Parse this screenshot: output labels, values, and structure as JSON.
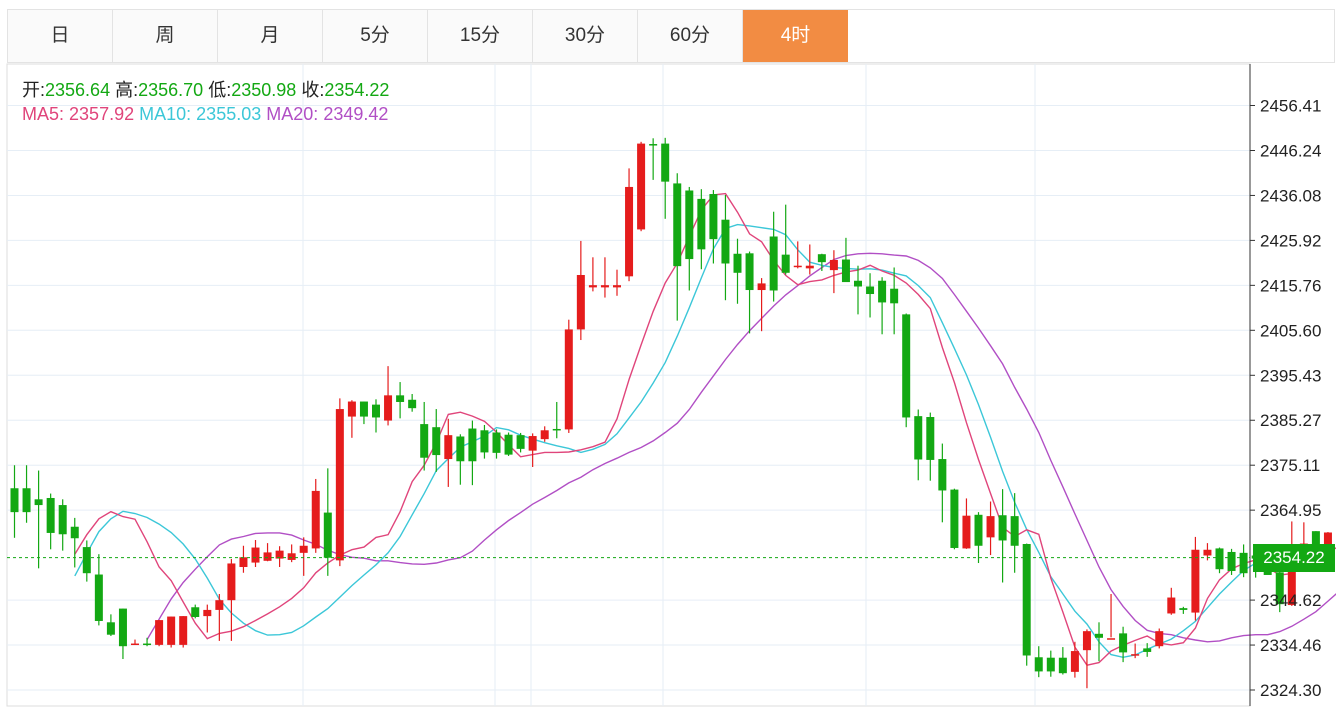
{
  "tabs": [
    {
      "label": "日",
      "active": false
    },
    {
      "label": "周",
      "active": false
    },
    {
      "label": "月",
      "active": false
    },
    {
      "label": "5分",
      "active": false
    },
    {
      "label": "15分",
      "active": false
    },
    {
      "label": "30分",
      "active": false
    },
    {
      "label": "60分",
      "active": false
    },
    {
      "label": "4时",
      "active": true
    }
  ],
  "colors": {
    "accent": "#f28c43",
    "up": "#e51c1c",
    "down": "#13a813",
    "ma5": "#e0457b",
    "ma10": "#3cc7d8",
    "ma20": "#b14fc5",
    "grid": "#e6eef6",
    "last_price": "#13a813"
  },
  "legend": {
    "open_label": "开:",
    "open_value": "2356.64",
    "high_label": "高:",
    "high_value": "2356.70",
    "low_label": "低:",
    "low_value": "2350.98",
    "close_label": "收:",
    "close_value": "2354.22",
    "ma5_label": "MA5:",
    "ma5_value": "2357.92",
    "ma10_label": "MA10:",
    "ma10_value": "2355.03",
    "ma20_label": "MA20:",
    "ma20_value": "2349.42"
  },
  "chart_data": {
    "type": "candlestick",
    "y_ticks": [
      "2456.41",
      "2446.24",
      "2436.08",
      "2425.92",
      "2415.76",
      "2405.60",
      "2395.43",
      "2385.27",
      "2375.11",
      "2364.95",
      "2344.62",
      "2334.46",
      "2324.30"
    ],
    "ylim": [
      2321.2,
      2466.0
    ],
    "last_price": "2354.22",
    "candles": [
      [
        2369.9,
        2364.5,
        2375.1,
        2358.7
      ],
      [
        2369.9,
        2364.5,
        2375.1,
        2362.1
      ],
      [
        2367.4,
        2366.1,
        2373.9,
        2351.8
      ],
      [
        2367.7,
        2359.8,
        2368.7,
        2356.1
      ],
      [
        2366.1,
        2359.5,
        2367.4,
        2355.8
      ],
      [
        2361.2,
        2358.6,
        2363.2,
        2352.0
      ],
      [
        2356.6,
        2350.7,
        2358.1,
        2348.8
      ],
      [
        2350.4,
        2339.9,
        2355.0,
        2338.9
      ],
      [
        2339.6,
        2336.8,
        2341.4,
        2336.5
      ],
      [
        2342.7,
        2334.2,
        2342.7,
        2331.3
      ],
      [
        2334.8,
        2334.8,
        2335.7,
        2334.5
      ],
      [
        2334.8,
        2334.5,
        2336.1,
        2334.2
      ],
      [
        2334.5,
        2340.1,
        2340.1,
        2334.2
      ],
      [
        2334.5,
        2340.9,
        2340.9,
        2333.9
      ],
      [
        2334.5,
        2341.0,
        2341.0,
        2333.9
      ],
      [
        2343.0,
        2340.8,
        2343.6,
        2340.5
      ],
      [
        2341.0,
        2342.4,
        2343.6,
        2337.3
      ],
      [
        2342.4,
        2344.6,
        2346.0,
        2335.4
      ],
      [
        2344.6,
        2352.9,
        2353.9,
        2335.4
      ],
      [
        2352.1,
        2354.3,
        2356.9,
        2350.8
      ],
      [
        2353.1,
        2356.5,
        2358.2,
        2352.1
      ],
      [
        2353.5,
        2355.4,
        2357.5,
        2353.4
      ],
      [
        2354.0,
        2355.8,
        2356.8,
        2352.1
      ],
      [
        2353.7,
        2355.2,
        2357.2,
        2353.2
      ],
      [
        2355.3,
        2356.9,
        2358.8,
        2350.1
      ],
      [
        2356.3,
        2369.3,
        2372.0,
        2355.3
      ],
      [
        2364.4,
        2354.2,
        2374.4,
        2350.1
      ],
      [
        2353.6,
        2387.8,
        2390.2,
        2352.3
      ],
      [
        2386.1,
        2389.5,
        2389.8,
        2381.3
      ],
      [
        2389.5,
        2386.1,
        2389.5,
        2384.4
      ],
      [
        2388.8,
        2385.9,
        2390.0,
        2382.5
      ],
      [
        2385.2,
        2390.9,
        2397.5,
        2384.1
      ],
      [
        2390.9,
        2389.4,
        2393.9,
        2385.7
      ],
      [
        2389.9,
        2388.0,
        2391.2,
        2387.2
      ],
      [
        2384.4,
        2376.8,
        2389.4,
        2373.9
      ],
      [
        2383.7,
        2377.4,
        2387.8,
        2373.6
      ],
      [
        2376.5,
        2381.9,
        2385.6,
        2370.2
      ],
      [
        2381.6,
        2376.0,
        2382.1,
        2370.7
      ],
      [
        2383.4,
        2376.0,
        2385.2,
        2370.6
      ],
      [
        2383.0,
        2378.0,
        2384.2,
        2376.6
      ],
      [
        2382.5,
        2377.9,
        2383.2,
        2376.6
      ],
      [
        2382.0,
        2377.5,
        2382.5,
        2377.2
      ],
      [
        2381.9,
        2378.8,
        2382.4,
        2378.0
      ],
      [
        2378.4,
        2381.7,
        2382.3,
        2374.7
      ],
      [
        2381.0,
        2383.0,
        2383.9,
        2380.4
      ],
      [
        2383.3,
        2383.2,
        2389.4,
        2381.2
      ],
      [
        2383.2,
        2405.8,
        2408.0,
        2382.4
      ],
      [
        2405.8,
        2418.1,
        2425.8,
        2403.4
      ],
      [
        2415.3,
        2415.8,
        2422.1,
        2414.4
      ],
      [
        2415.3,
        2415.8,
        2422.1,
        2413.0
      ],
      [
        2415.3,
        2415.8,
        2419.3,
        2413.4
      ],
      [
        2417.8,
        2438.0,
        2442.2,
        2416.7
      ],
      [
        2428.4,
        2447.8,
        2448.2,
        2428.0
      ],
      [
        2447.7,
        2447.5,
        2449.0,
        2439.6
      ],
      [
        2447.8,
        2439.2,
        2449.1,
        2430.8
      ],
      [
        2438.8,
        2420.1,
        2441.1,
        2407.8
      ],
      [
        2437.2,
        2421.7,
        2438.0,
        2414.6
      ],
      [
        2435.3,
        2423.9,
        2437.5,
        2419.4
      ],
      [
        2436.4,
        2426.2,
        2437.3,
        2420.7
      ],
      [
        2430.6,
        2420.7,
        2436.2,
        2412.4
      ],
      [
        2422.9,
        2418.6,
        2426.3,
        2411.6
      ],
      [
        2423.0,
        2414.7,
        2423.4,
        2404.9
      ],
      [
        2414.7,
        2416.2,
        2417.4,
        2405.4
      ],
      [
        2426.8,
        2414.6,
        2432.4,
        2412.1
      ],
      [
        2422.7,
        2418.6,
        2434.0,
        2418.2
      ],
      [
        2419.9,
        2420.2,
        2425.7,
        2419.6
      ],
      [
        2419.6,
        2420.2,
        2425.0,
        2418.2
      ],
      [
        2422.8,
        2421.0,
        2422.9,
        2419.0
      ],
      [
        2419.2,
        2421.5,
        2423.7,
        2414.0
      ],
      [
        2421.6,
        2416.5,
        2426.5,
        2417.6
      ],
      [
        2416.8,
        2415.5,
        2420.2,
        2409.2
      ],
      [
        2415.5,
        2413.8,
        2418.5,
        2408.5
      ],
      [
        2416.8,
        2411.9,
        2417.6,
        2404.7
      ],
      [
        2415.0,
        2411.7,
        2419.8,
        2404.7
      ],
      [
        2409.2,
        2385.9,
        2409.4,
        2383.7
      ],
      [
        2386.2,
        2376.4,
        2387.7,
        2371.7
      ],
      [
        2386.0,
        2376.3,
        2387.0,
        2371.6
      ],
      [
        2376.5,
        2369.4,
        2380.0,
        2362.2
      ],
      [
        2369.6,
        2356.4,
        2369.8,
        2356.1
      ],
      [
        2356.3,
        2363.7,
        2367.6,
        2356.2
      ],
      [
        2363.9,
        2356.9,
        2364.5,
        2353.0
      ],
      [
        2358.8,
        2363.6,
        2366.9,
        2354.8
      ],
      [
        2363.8,
        2358.1,
        2369.7,
        2348.6
      ],
      [
        2363.6,
        2356.9,
        2368.8,
        2350.8
      ],
      [
        2357.3,
        2332.1,
        2357.4,
        2329.8
      ],
      [
        2331.7,
        2328.5,
        2334.2,
        2327.2
      ],
      [
        2331.6,
        2328.5,
        2333.2,
        2327.3
      ],
      [
        2331.6,
        2328.1,
        2334.0,
        2327.8
      ],
      [
        2328.4,
        2333.1,
        2335.2,
        2327.1
      ],
      [
        2333.3,
        2337.6,
        2338.0,
        2324.7
      ],
      [
        2337.0,
        2336.1,
        2339.6,
        2330.8
      ],
      [
        2336.0,
        2336.0,
        2346.0,
        2336.2
      ],
      [
        2337.1,
        2332.8,
        2338.6,
        2330.6
      ],
      [
        2332.2,
        2332.4,
        2334.8,
        2331.5
      ],
      [
        2333.7,
        2332.9,
        2334.9,
        2331.8
      ],
      [
        2334.2,
        2337.6,
        2338.2,
        2333.7
      ],
      [
        2341.6,
        2345.2,
        2347.4,
        2341.3
      ],
      [
        2342.8,
        2342.4,
        2343.1,
        2341.5
      ],
      [
        2341.8,
        2356.0,
        2358.9,
        2340.0
      ],
      [
        2354.7,
        2356.0,
        2357.5,
        2353.6
      ],
      [
        2356.3,
        2351.6,
        2356.5,
        2350.7
      ],
      [
        2355.5,
        2351.2,
        2356.2,
        2350.3
      ],
      [
        2355.3,
        2350.7,
        2357.2,
        2349.8
      ],
      [
        2354.7,
        2354.0,
        2356.9,
        2349.7
      ],
      [
        2352.1,
        2350.3,
        2354.3,
        2350.8
      ],
      [
        2350.9,
        2343.7,
        2351.9,
        2341.9
      ],
      [
        2343.5,
        2353.9,
        2362.4,
        2343.3
      ],
      [
        2353.8,
        2357.4,
        2362.2,
        2352.6
      ],
      [
        2360.2,
        2355.5,
        2360.2,
        2352.9
      ],
      [
        2355.5,
        2359.9,
        2360.0,
        2354.2
      ],
      [
        2359.3,
        2355.5,
        2360.9,
        2352.9
      ],
      [
        2361.4,
        2357.3,
        2361.6,
        2354.3
      ],
      [
        2356.9,
        2355.9,
        2357.3,
        2355.4
      ],
      [
        2356.6,
        2354.2,
        2356.7,
        2351.0
      ]
    ],
    "ma5": [
      2355.0,
      2359.4,
      2363.0,
      2364.6,
      2363.5,
      2362.9,
      2357.8,
      2352.1,
      2349.0,
      2344.2,
      2339.4,
      2335.9,
      2337.1,
      2337.6,
      2338.6,
      2340.0,
      2341.5,
      2343.1,
      2345.0,
      2347.4,
      2350.8,
      2353.0,
      2354.8,
      2356.0,
      2356.6,
      2358.8,
      2359.4,
      2364.6,
      2371.4,
      2375.1,
      2380.2,
      2386.6,
      2387.1,
      2386.2,
      2385.0,
      2382.6,
      2379.7,
      2377.0,
      2377.5,
      2378.0,
      2378.0,
      2378.1,
      2378.6,
      2379.3,
      2380.3,
      2385.6,
      2394.5,
      2402.3,
      2409.9,
      2416.3,
      2420.8,
      2426.8,
      2432.8,
      2436.2,
      2436.5,
      2432.3,
      2427.4,
      2425.6,
      2421.4,
      2418.0,
      2415.9,
      2416.6,
      2417.0,
      2418.0,
      2418.8,
      2419.2,
      2420.3,
      2419.0,
      2418.0,
      2416.3,
      2413.7,
      2410.5,
      2401.7,
      2393.8,
      2384.7,
      2376.4,
      2368.7,
      2361.1,
      2359.0,
      2360.5,
      2359.5,
      2349.6,
      2341.9,
      2334.0,
      2329.9,
      2330.5,
      2333.1,
      2334.4,
      2335.5,
      2336.5,
      2334.9,
      2334.5,
      2335.0,
      2338.3,
      2345.0,
      2349.2,
      2351.7,
      2352.9,
      2353.7,
      2351.9,
      2350.3,
      2350.6,
      2352.3,
      2354.0,
      2355.9,
      2356.6,
      2357.4,
      2357.7,
      2357.5
    ],
    "ma10": [
      2350.1,
      2355.2,
      2360.1,
      2363.0,
      2364.7,
      2364.2,
      2363.3,
      2361.8,
      2359.9,
      2357.3,
      2353.9,
      2349.6,
      2344.8,
      2341.7,
      2339.4,
      2337.7,
      2336.7,
      2336.8,
      2337.3,
      2338.8,
      2340.8,
      2342.7,
      2345.3,
      2347.9,
      2350.3,
      2352.6,
      2355.3,
      2359.0,
      2363.9,
      2368.7,
      2373.9,
      2376.6,
      2379.2,
      2380.4,
      2381.7,
      2383.6,
      2383.1,
      2381.9,
      2381.0,
      2380.2,
      2379.5,
      2378.9,
      2378.0,
      2378.7,
      2379.8,
      2382.2,
      2385.8,
      2389.4,
      2393.7,
      2398.3,
      2404.3,
      2410.7,
      2417.5,
      2424.0,
      2428.6,
      2429.5,
      2429.2,
      2428.8,
      2428.4,
      2427.2,
      2423.8,
      2421.0,
      2420.3,
      2419.8,
      2419.6,
      2419.4,
      2419.5,
      2419.2,
      2418.5,
      2417.9,
      2415.7,
      2413.0,
      2407.3,
      2401.5,
      2395.5,
      2388.8,
      2381.4,
      2373.7,
      2366.7,
      2360.6,
      2355.4,
      2349.9,
      2346.0,
      2342.1,
      2339.2,
      2335.2,
      2332.3,
      2331.7,
      2332.2,
      2333.5,
      2334.7,
      2335.8,
      2337.7,
      2339.8,
      2342.9,
      2346.0,
      2348.7,
      2351.3,
      2353.0,
      2353.4,
      2353.2,
      2353.7,
      2354.4,
      2354.9,
      2356.0,
      2356.5,
      2357.1,
      2357.4,
      2355.0
    ],
    "ma20": [
      2335.7,
      2340.3,
      2344.9,
      2348.6,
      2351.6,
      2354.4,
      2357.1,
      2358.4,
      2359.0,
      2359.7,
      2359.8,
      2359.8,
      2359.3,
      2358.2,
      2357.2,
      2355.9,
      2354.9,
      2354.3,
      2354.1,
      2353.5,
      2353.5,
      2353.1,
      2352.8,
      2352.7,
      2353.0,
      2353.7,
      2354.2,
      2355.7,
      2358.2,
      2360.5,
      2362.6,
      2364.4,
      2366.3,
      2367.8,
      2369.4,
      2371.1,
      2372.4,
      2374.1,
      2375.5,
      2376.7,
      2378.0,
      2379.1,
      2380.6,
      2382.5,
      2384.6,
      2387.7,
      2391.6,
      2395.3,
      2399.0,
      2402.4,
      2405.5,
      2408.3,
      2411.1,
      2413.6,
      2415.7,
      2417.9,
      2419.8,
      2421.6,
      2422.5,
      2422.9,
      2423.0,
      2422.9,
      2422.6,
      2422.4,
      2421.4,
      2419.7,
      2417.3,
      2413.7,
      2409.9,
      2406.1,
      2402.1,
      2398.0,
      2392.7,
      2387.8,
      2382.5,
      2376.2,
      2370.2,
      2364.1,
      2358.1,
      2352.1,
      2347.0,
      2343.2,
      2340.0,
      2337.8,
      2337.1,
      2336.8,
      2336.1,
      2335.6,
      2335.2,
      2335.4,
      2336.1,
      2336.6,
      2336.8,
      2336.8,
      2337.5,
      2338.7,
      2340.3,
      2342.0,
      2344.4,
      2346.8,
      2348.7,
      2349.5,
      2349.4
    ]
  }
}
